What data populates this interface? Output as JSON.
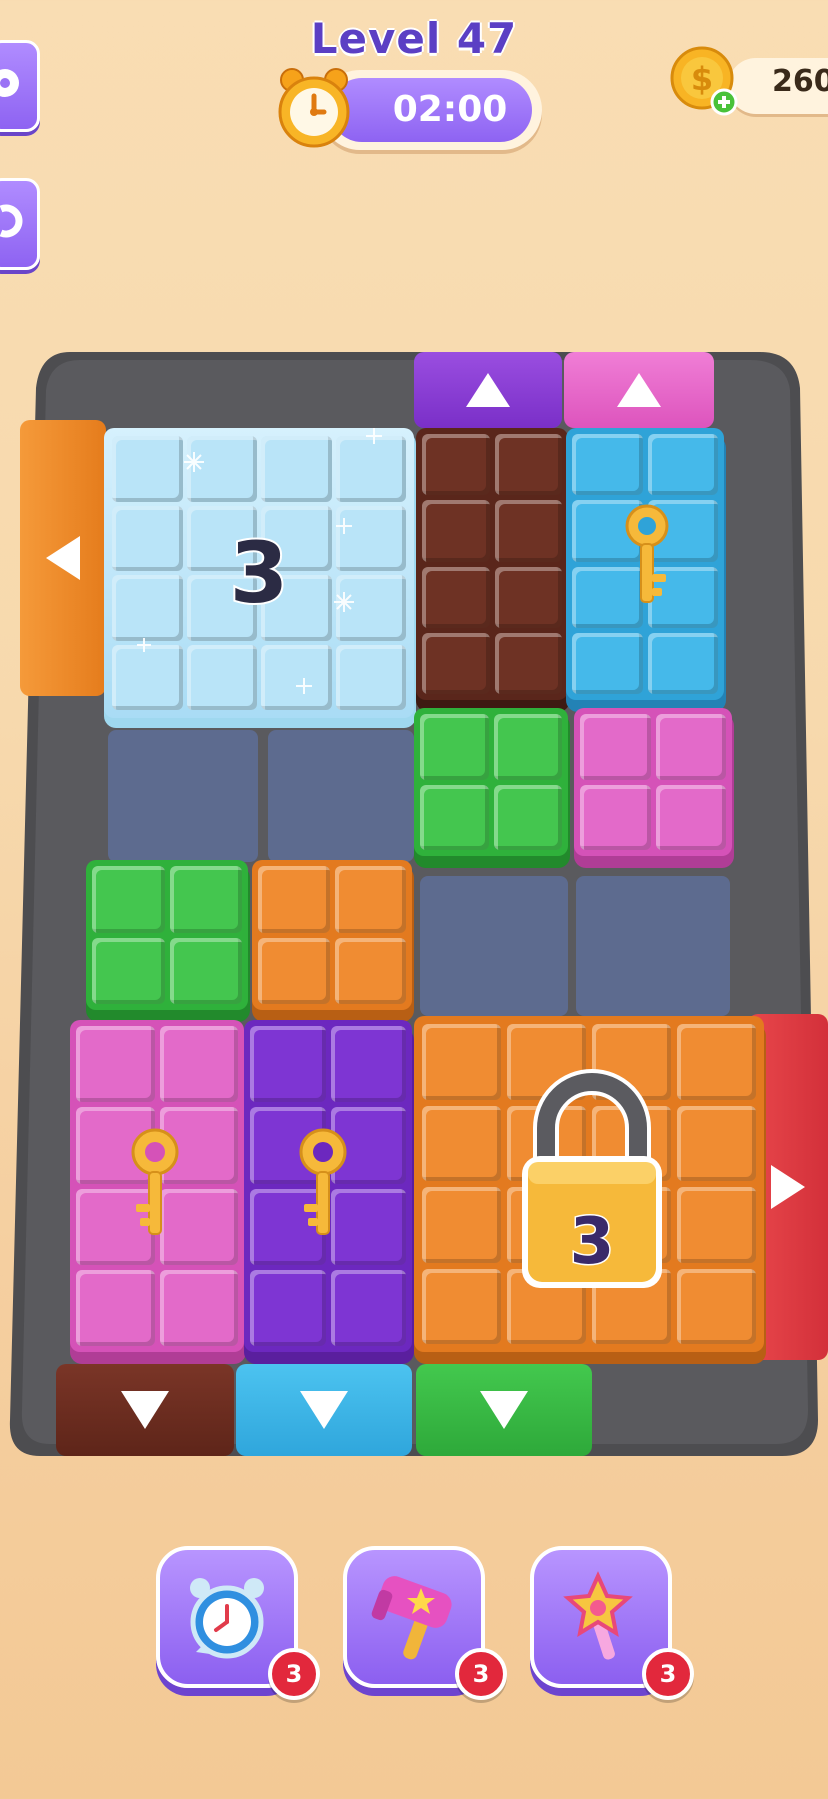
{
  "header": {
    "level_label": "Level 47",
    "timer": "02:00",
    "coins": "260"
  },
  "board": {
    "frozen_block_counter": "3",
    "lock_counter": "3"
  },
  "boosters": [
    {
      "name": "freeze-clock",
      "count": "3"
    },
    {
      "name": "hammer",
      "count": "3"
    },
    {
      "name": "magic-wand",
      "count": "3"
    }
  ],
  "colors": {
    "frame": "#4a4a4c",
    "empty_cell": "#5d6b8f",
    "orange": "#f08a2a",
    "green": "#3fbf4a",
    "pink": "#e35fc8",
    "purple": "#7d2fd0",
    "blue": "#3fb3e6",
    "brown": "#6b2e22",
    "red": "#e03a3f",
    "ice": "#bfe6fb"
  }
}
